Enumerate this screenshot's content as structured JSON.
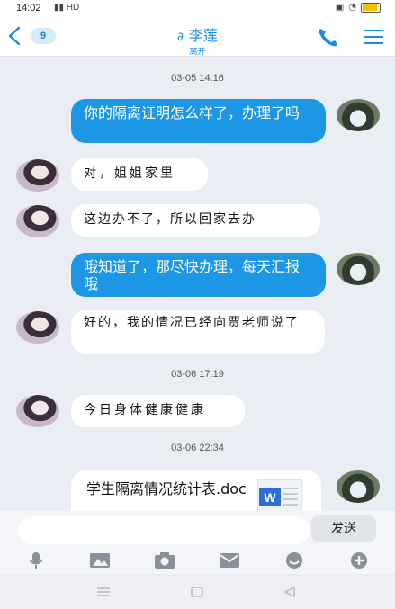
{
  "status_bar": {
    "time": "14:02",
    "signal_text": "HD"
  },
  "header": {
    "unread_count": "9",
    "contact_name": "李莲",
    "contact_status": "离开"
  },
  "messages": [
    {
      "type": "timestamp",
      "text": "03-05 14:16"
    },
    {
      "type": "outgoing",
      "text": "你的隔离证明怎么样了，办理了吗"
    },
    {
      "type": "incoming",
      "text": "对，姐姐家里"
    },
    {
      "type": "incoming",
      "text": "这边办不了，所以回家去办"
    },
    {
      "type": "outgoing",
      "text": "哦知道了，那尽快办理，每天汇报哦"
    },
    {
      "type": "incoming",
      "text": "好的，我的情况已经向贾老师说了"
    },
    {
      "type": "timestamp",
      "text": "03-06 17:19"
    },
    {
      "type": "incoming",
      "text": "今日身体健康健康"
    },
    {
      "type": "timestamp",
      "text": "03-06 22:34"
    },
    {
      "type": "outgoing_file",
      "file_name": "学生隔离情况统计表.doc",
      "file_type_icon": "word-doc-icon"
    }
  ],
  "composer": {
    "input_value": "",
    "send_label": "发送"
  },
  "toolbar_icons": [
    "microphone-icon",
    "image-icon",
    "camera-icon",
    "envelope-icon",
    "emoji-icon",
    "plus-icon"
  ],
  "colors": {
    "accent": "#1a8be0",
    "outgoing_bubble": "#1b97e6",
    "background": "#ebedf5"
  }
}
